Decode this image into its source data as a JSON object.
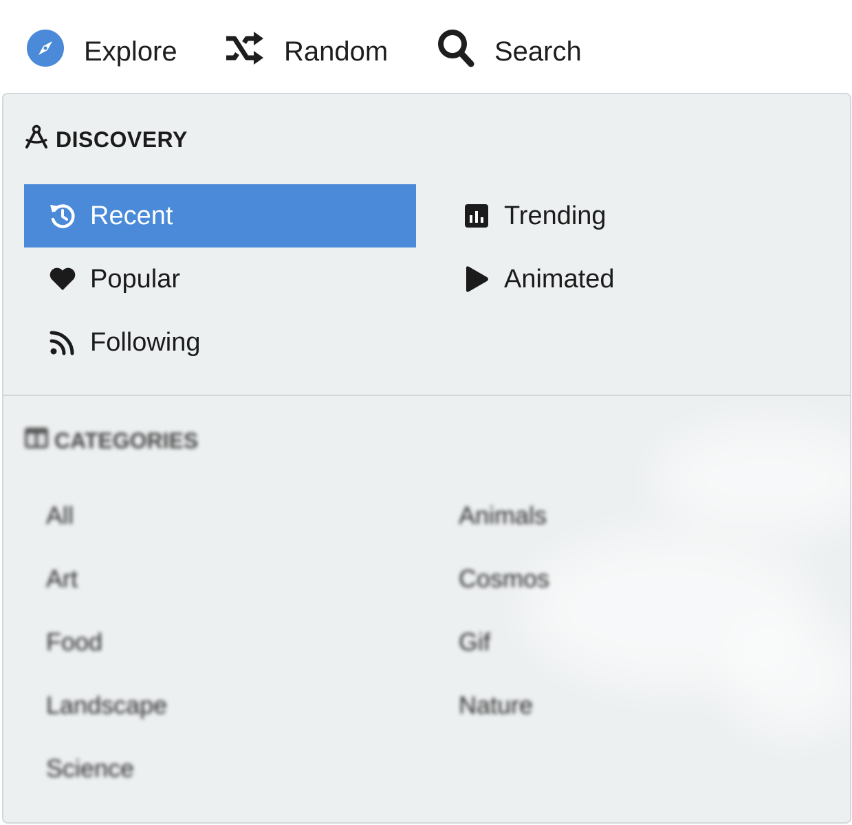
{
  "nav": {
    "explore": {
      "label": "Explore",
      "icon": "compass-icon",
      "icon_color": "#4a8ad8"
    },
    "random": {
      "label": "Random",
      "icon": "shuffle-icon"
    },
    "search": {
      "label": "Search",
      "icon": "magnifier-icon"
    }
  },
  "discovery": {
    "heading": "DISCOVERY",
    "heading_icon": "drafting-compass-icon",
    "active_color": "#4a8ad8",
    "items": [
      {
        "label": "Recent",
        "icon": "history-icon",
        "active": true
      },
      {
        "label": "Trending",
        "icon": "bar-chart-icon",
        "active": false
      },
      {
        "label": "Popular",
        "icon": "heart-icon",
        "active": false
      },
      {
        "label": "Animated",
        "icon": "play-icon",
        "active": false
      },
      {
        "label": "Following",
        "icon": "rss-icon",
        "active": false
      }
    ]
  },
  "categories": {
    "heading": "CATEGORIES",
    "heading_icon": "columns-icon",
    "items": [
      "All",
      "Animals",
      "Art",
      "Cosmos",
      "Food",
      "Gif",
      "Landscape",
      "Nature",
      "Science"
    ]
  }
}
